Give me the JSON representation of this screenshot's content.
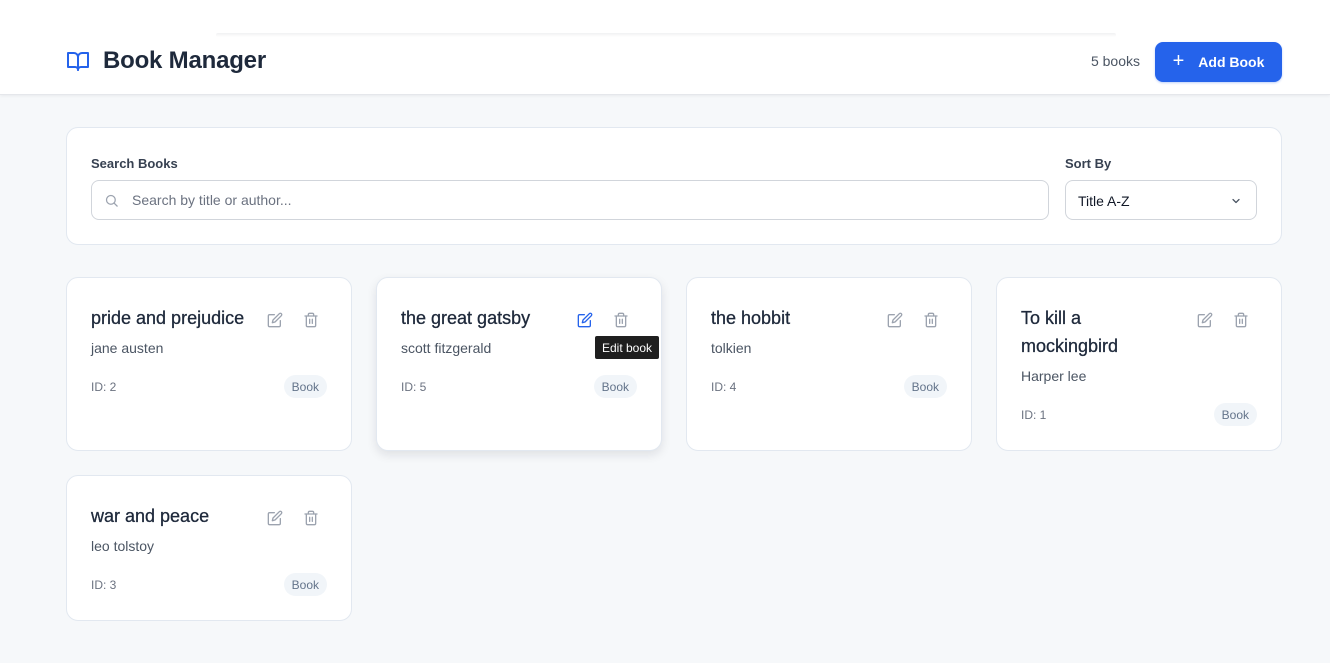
{
  "header": {
    "title": "Book Manager",
    "book_count": "5 books",
    "add_button_label": "Add Book",
    "brand_icon": "book-open-icon"
  },
  "filters": {
    "search_label": "Search Books",
    "search_placeholder": "Search by title or author...",
    "search_value": "",
    "sort_label": "Sort By",
    "sort_value": "Title A-Z"
  },
  "books": [
    {
      "title": "pride and prejudice",
      "author": "jane austen",
      "id": "ID: 2",
      "badge": "Book"
    },
    {
      "title": "the great gatsby",
      "author": "scott fitzgerald",
      "id": "ID: 5",
      "badge": "Book"
    },
    {
      "title": "the hobbit",
      "author": "tolkien",
      "id": "ID: 4",
      "badge": "Book"
    },
    {
      "title": "To kill a mockingbird",
      "author": "Harper lee",
      "id": "ID: 1",
      "badge": "Book"
    },
    {
      "title": "war and peace",
      "author": "leo tolstoy",
      "id": "ID: 3",
      "badge": "Book"
    }
  ],
  "tooltip": {
    "text": "Edit book"
  },
  "colors": {
    "accent": "#2563eb",
    "background": "#f6f8fa",
    "tooltip_bg": "#1f1f1f"
  }
}
